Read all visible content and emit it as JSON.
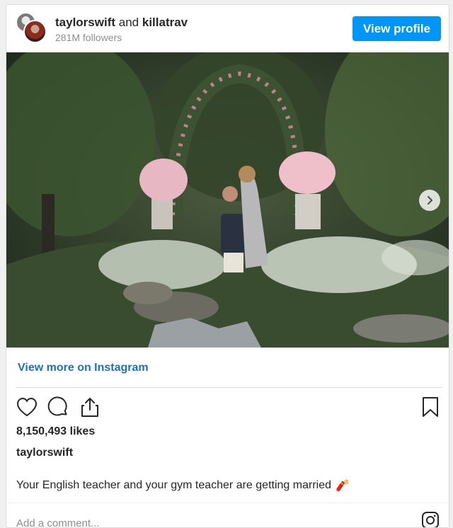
{
  "header": {
    "account_primary": "taylorswift",
    "connector": "and",
    "account_secondary": "killatrav",
    "followers": "281M followers",
    "view_profile_label": "View profile"
  },
  "photo": {
    "description_icon": "garden-proposal-photo"
  },
  "links": {
    "view_more": "View more on Instagram"
  },
  "actions": {
    "icons": [
      "heart-icon",
      "comment-icon",
      "share-icon",
      "bookmark-icon"
    ]
  },
  "post": {
    "likes": "8,150,493 likes",
    "username": "taylorswift",
    "caption": "Your English teacher and your gym teacher are getting married",
    "caption_emoji": "🧨"
  },
  "comment": {
    "placeholder": "Add a comment..."
  },
  "colors": {
    "accent": "#0095f6",
    "link": "#1d72b8"
  }
}
